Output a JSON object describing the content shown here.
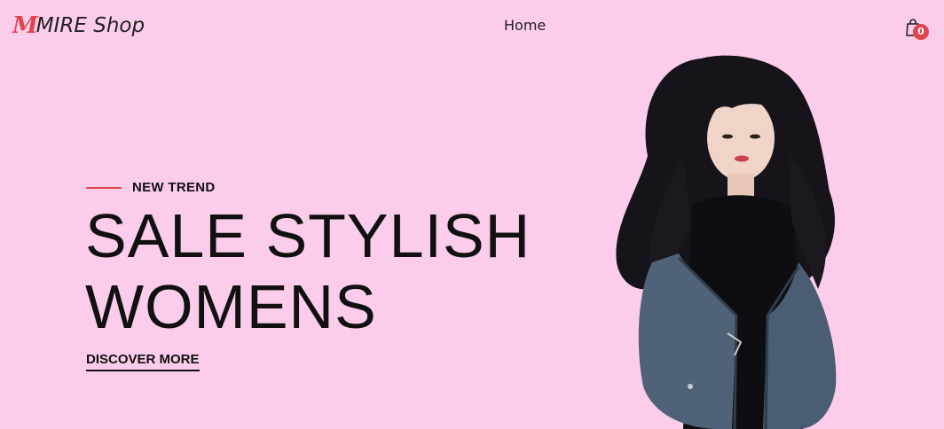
{
  "header": {
    "logo_mark": "M",
    "logo_text": "MIRE Shop",
    "nav_home": "Home",
    "cart_count": "0"
  },
  "hero": {
    "eyebrow": "NEW TREND",
    "headline_line1": "SALE STYLISH",
    "headline_line2": "WOMENS",
    "cta_label": "DISCOVER MORE"
  },
  "colors": {
    "background": "#fbcdea",
    "accent": "#e0454e",
    "text": "#111111"
  },
  "icons": {
    "cart": "shopping-bag-icon"
  }
}
